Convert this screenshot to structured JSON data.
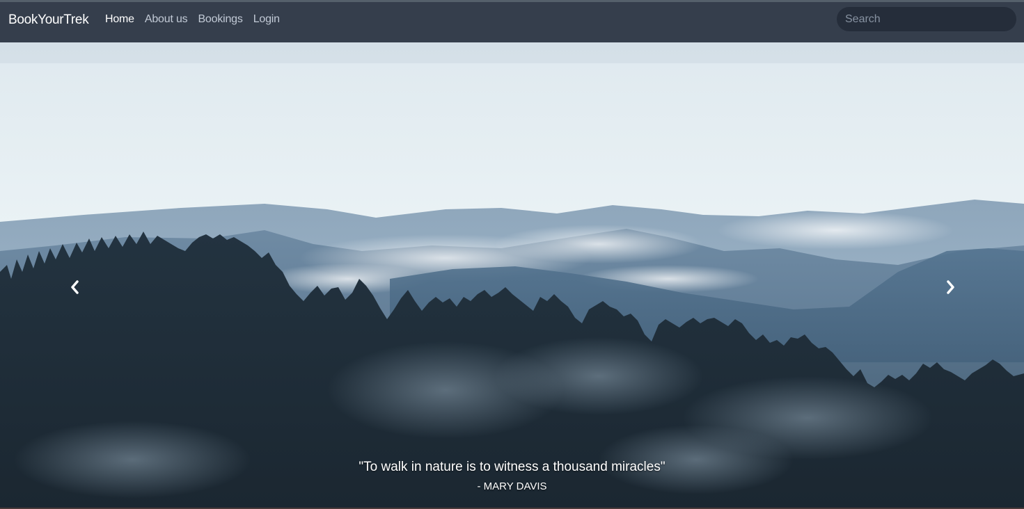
{
  "navbar": {
    "brand": "BookYourTrek",
    "links": [
      {
        "label": "Home",
        "active": true
      },
      {
        "label": "About us",
        "active": false
      },
      {
        "label": "Bookings",
        "active": false
      },
      {
        "label": "Login",
        "active": false
      }
    ],
    "search_placeholder": "Search"
  },
  "hero": {
    "quote": "\"To walk in nature is to witness a thousand miracles\"",
    "author": "- MARY DAVIS",
    "prev_icon": "chevron-left-icon",
    "next_icon": "chevron-right-icon"
  },
  "colors": {
    "navbar_bg": "#353e4c",
    "search_bg": "#252d3a",
    "sky": "#e8f1f4",
    "forest": "#1e2b36"
  }
}
